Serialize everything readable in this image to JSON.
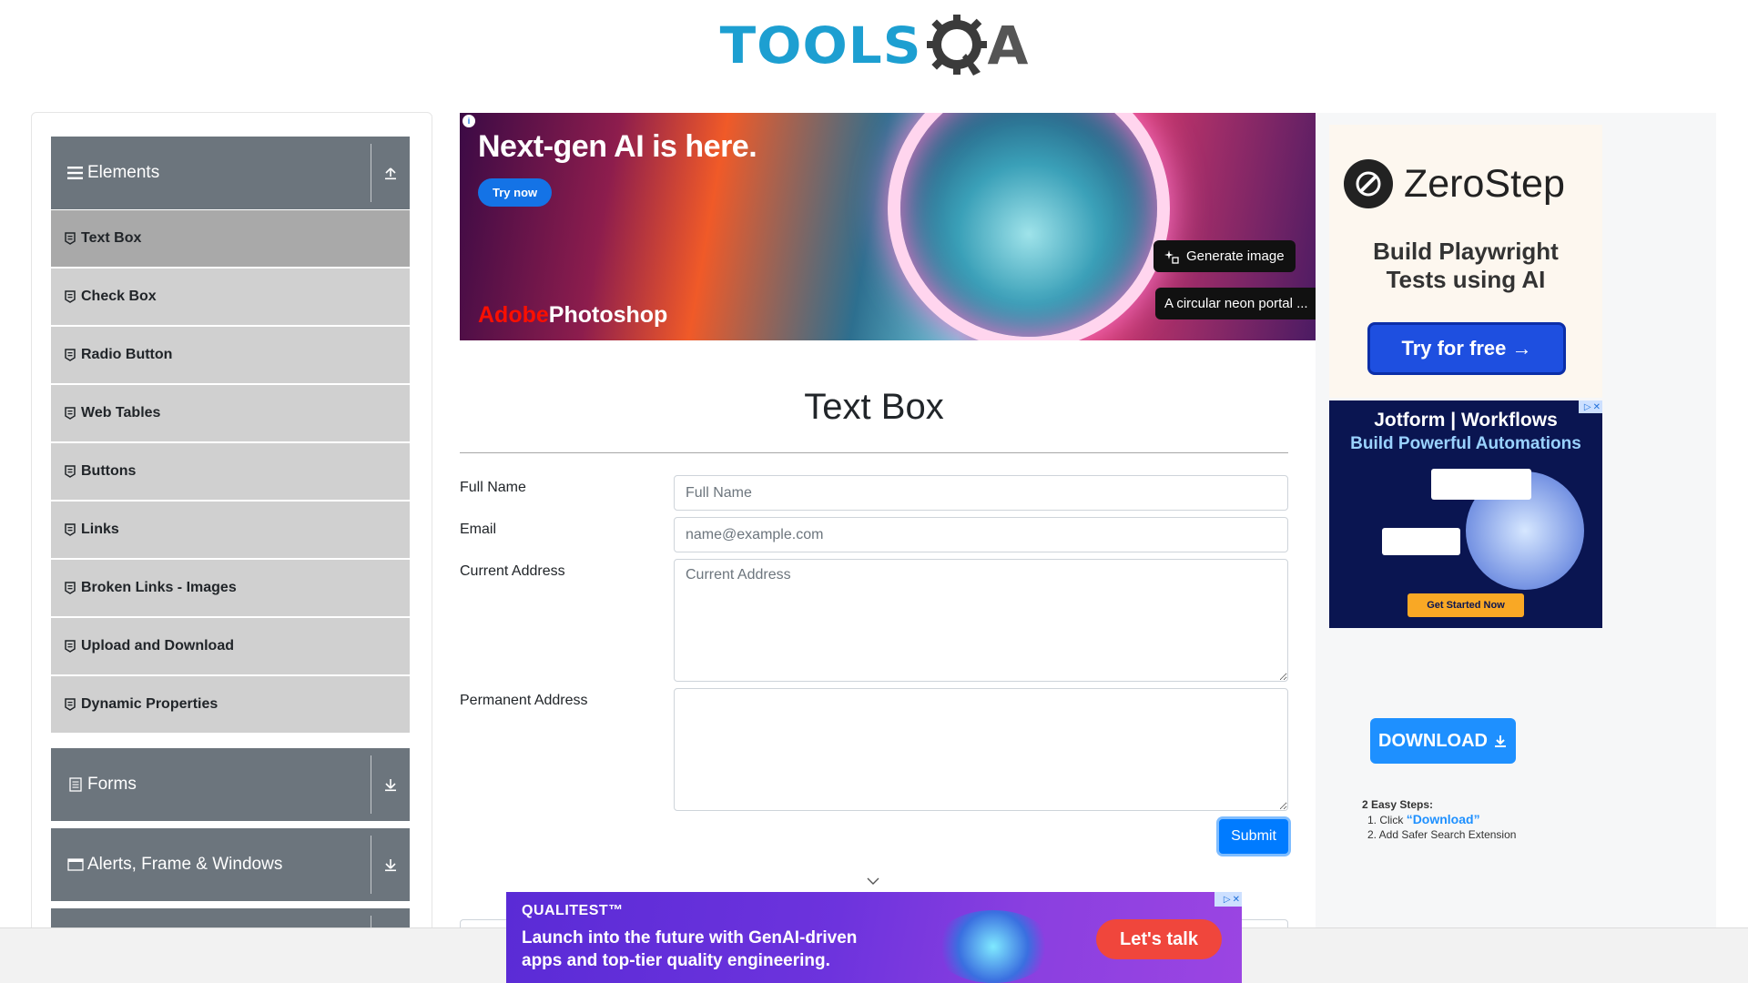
{
  "header": {
    "logo_text": "TOOLS",
    "logo_suffix": "A"
  },
  "sidebar": {
    "groups": [
      {
        "label": "Elements",
        "icon": "hamburger-icon",
        "toggle": "collapse-up-icon"
      },
      {
        "label": "Forms",
        "icon": "document-icon",
        "toggle": "expand-down-icon"
      },
      {
        "label": "Alerts, Frame & Windows",
        "icon": "window-icon",
        "toggle": "expand-down-icon"
      }
    ],
    "items": [
      {
        "label": "Text Box",
        "active": true
      },
      {
        "label": "Check Box"
      },
      {
        "label": "Radio Button"
      },
      {
        "label": "Web Tables"
      },
      {
        "label": "Buttons"
      },
      {
        "label": "Links"
      },
      {
        "label": "Broken Links - Images"
      },
      {
        "label": "Upload and Download"
      },
      {
        "label": "Dynamic Properties"
      }
    ]
  },
  "top_ad": {
    "headline": "Next-gen AI is here.",
    "cta": "Try now",
    "brand_adobe": "Adobe",
    "brand_product": "Photoshop",
    "generate": "Generate image",
    "prompt": "A circular neon portal ..."
  },
  "page": {
    "title": "Text Box"
  },
  "form": {
    "full_name": {
      "label": "Full Name",
      "placeholder": "Full Name",
      "value": ""
    },
    "email": {
      "label": "Email",
      "placeholder": "name@example.com",
      "value": ""
    },
    "current_address": {
      "label": "Current Address",
      "placeholder": "Current Address",
      "value": ""
    },
    "permanent_address": {
      "label": "Permanent Address",
      "placeholder": "",
      "value": ""
    },
    "submit": "Submit"
  },
  "right_ads": {
    "zerostep": {
      "name": "ZeroStep",
      "tagline_1": "Build Playwright",
      "tagline_2": "Tests using AI",
      "cta": "Try for free →"
    },
    "jotform": {
      "brand": "Jotform | Workflows",
      "tagline": "Build Powerful Automations",
      "cta": "Get Started Now"
    },
    "download": {
      "button": "DOWNLOAD",
      "steps_title": "2 Easy Steps:",
      "step1_prefix": "1. Click ",
      "step1_link": "“Download”",
      "step2": "2. Add Safer Search Extension"
    }
  },
  "bottom_ad": {
    "brand": "QUALITEST™",
    "line1": "Launch into the future with GenAI-driven",
    "line2": "apps and top-tier quality engineering.",
    "cta": "Let's talk"
  },
  "colors": {
    "sidebar_header": "#6c757d",
    "menu_item": "#d0d0d0",
    "menu_item_active": "#a9a9a9",
    "submit": "#007bff",
    "logo_blue": "#1d9fd1"
  }
}
